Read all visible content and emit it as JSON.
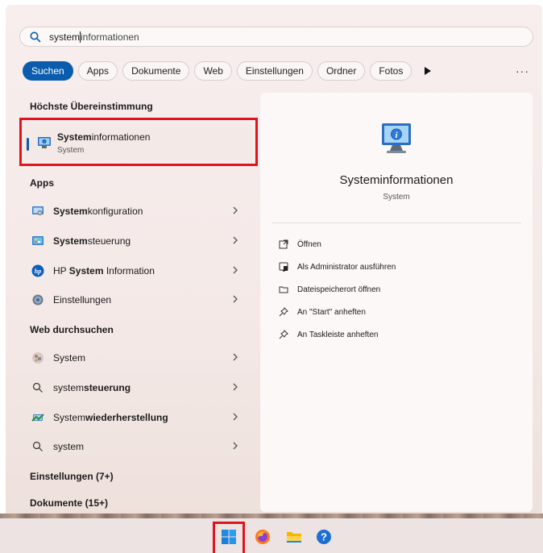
{
  "search": {
    "typed": "system",
    "completion": "informationen"
  },
  "filters": {
    "items": [
      "Suchen",
      "Apps",
      "Dokumente",
      "Web",
      "Einstellungen",
      "Ordner",
      "Fotos"
    ],
    "more": "···"
  },
  "best_match": {
    "heading": "Höchste Übereinstimmung",
    "title_bold": "System",
    "title_rest": "informationen",
    "subtitle": "System"
  },
  "apps": {
    "heading": "Apps",
    "items": [
      {
        "bold": "System",
        "rest": "konfiguration",
        "icon": "msconfig-icon"
      },
      {
        "bold": "System",
        "rest": "steuerung",
        "icon": "control-panel-icon"
      },
      {
        "pre": "HP ",
        "bold": "System",
        "rest": " Information",
        "icon": "hp-icon"
      },
      {
        "pre": "Einstellungen",
        "icon": "settings-gear-icon"
      }
    ]
  },
  "web": {
    "heading": "Web durchsuchen",
    "items": [
      {
        "pre": "System",
        "icon": "web-thumbnail-icon"
      },
      {
        "pre": "system",
        "bold": "steuerung",
        "icon": "search-icon"
      },
      {
        "pre": "System",
        "bold": "wiederherstellung",
        "icon": "system-restore-icon"
      },
      {
        "pre": "system",
        "icon": "search-icon"
      }
    ]
  },
  "more_sections": {
    "settings": "Einstellungen (7+)",
    "documents": "Dokumente (15+)"
  },
  "preview": {
    "title": "Systeminformationen",
    "subtitle": "System",
    "actions": [
      {
        "label": "Öffnen",
        "icon": "open-external-icon"
      },
      {
        "label": "Als Administrator ausführen",
        "icon": "admin-shield-icon"
      },
      {
        "label": "Dateispeicherort öffnen",
        "icon": "folder-icon"
      },
      {
        "label": "An \"Start\" anheften",
        "icon": "pin-icon"
      },
      {
        "label": "An Taskleiste anheften",
        "icon": "pin-icon"
      }
    ]
  },
  "taskbar": {
    "icons": [
      "windows-start-icon",
      "firefox-icon",
      "file-explorer-icon",
      "help-icon"
    ]
  },
  "colors": {
    "accent": "#0b5cad",
    "highlight_box": "#e0141e"
  }
}
